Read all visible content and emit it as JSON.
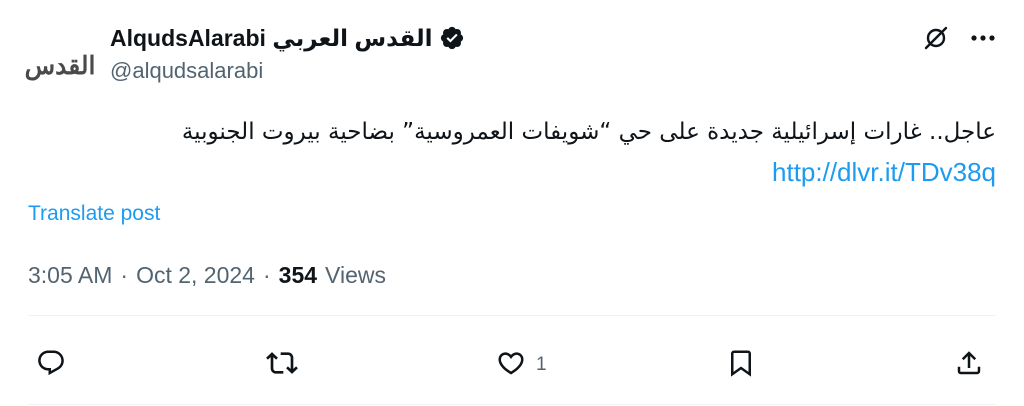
{
  "author": {
    "avatar_text": "القدس",
    "display_name": "AlqudsAlarabi القدس العربي",
    "handle": "@alqudsalarabi",
    "verified_icon": "verified-badge-icon"
  },
  "tweet": {
    "text": "عاجل.. غارات إسرائيلية جديدة على حي “شويفات العمروسية” بضاحية بيروت الجنوبية",
    "link": "http://dlvr.it/TDv38q",
    "translate_label": "Translate post"
  },
  "meta": {
    "time": "3:05 AM",
    "separator": "·",
    "date": "Oct 2, 2024",
    "views_count": "354",
    "views_label": "Views"
  },
  "actions": {
    "like_count": "1"
  },
  "colors": {
    "link": "#1d9bf0",
    "secondary_text": "#536471",
    "primary_text": "#0f1419"
  }
}
